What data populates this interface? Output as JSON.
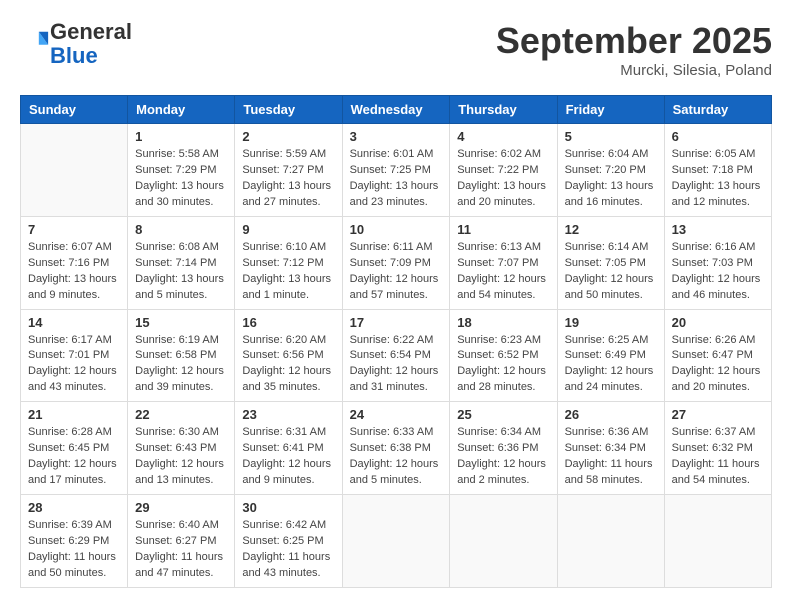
{
  "header": {
    "logo_general": "General",
    "logo_blue": "Blue",
    "month": "September 2025",
    "location": "Murcki, Silesia, Poland"
  },
  "days_of_week": [
    "Sunday",
    "Monday",
    "Tuesday",
    "Wednesday",
    "Thursday",
    "Friday",
    "Saturday"
  ],
  "weeks": [
    [
      {
        "day": null,
        "info": null
      },
      {
        "day": "1",
        "info": "Sunrise: 5:58 AM\nSunset: 7:29 PM\nDaylight: 13 hours\nand 30 minutes."
      },
      {
        "day": "2",
        "info": "Sunrise: 5:59 AM\nSunset: 7:27 PM\nDaylight: 13 hours\nand 27 minutes."
      },
      {
        "day": "3",
        "info": "Sunrise: 6:01 AM\nSunset: 7:25 PM\nDaylight: 13 hours\nand 23 minutes."
      },
      {
        "day": "4",
        "info": "Sunrise: 6:02 AM\nSunset: 7:22 PM\nDaylight: 13 hours\nand 20 minutes."
      },
      {
        "day": "5",
        "info": "Sunrise: 6:04 AM\nSunset: 7:20 PM\nDaylight: 13 hours\nand 16 minutes."
      },
      {
        "day": "6",
        "info": "Sunrise: 6:05 AM\nSunset: 7:18 PM\nDaylight: 13 hours\nand 12 minutes."
      }
    ],
    [
      {
        "day": "7",
        "info": "Sunrise: 6:07 AM\nSunset: 7:16 PM\nDaylight: 13 hours\nand 9 minutes."
      },
      {
        "day": "8",
        "info": "Sunrise: 6:08 AM\nSunset: 7:14 PM\nDaylight: 13 hours\nand 5 minutes."
      },
      {
        "day": "9",
        "info": "Sunrise: 6:10 AM\nSunset: 7:12 PM\nDaylight: 13 hours\nand 1 minute."
      },
      {
        "day": "10",
        "info": "Sunrise: 6:11 AM\nSunset: 7:09 PM\nDaylight: 12 hours\nand 57 minutes."
      },
      {
        "day": "11",
        "info": "Sunrise: 6:13 AM\nSunset: 7:07 PM\nDaylight: 12 hours\nand 54 minutes."
      },
      {
        "day": "12",
        "info": "Sunrise: 6:14 AM\nSunset: 7:05 PM\nDaylight: 12 hours\nand 50 minutes."
      },
      {
        "day": "13",
        "info": "Sunrise: 6:16 AM\nSunset: 7:03 PM\nDaylight: 12 hours\nand 46 minutes."
      }
    ],
    [
      {
        "day": "14",
        "info": "Sunrise: 6:17 AM\nSunset: 7:01 PM\nDaylight: 12 hours\nand 43 minutes."
      },
      {
        "day": "15",
        "info": "Sunrise: 6:19 AM\nSunset: 6:58 PM\nDaylight: 12 hours\nand 39 minutes."
      },
      {
        "day": "16",
        "info": "Sunrise: 6:20 AM\nSunset: 6:56 PM\nDaylight: 12 hours\nand 35 minutes."
      },
      {
        "day": "17",
        "info": "Sunrise: 6:22 AM\nSunset: 6:54 PM\nDaylight: 12 hours\nand 31 minutes."
      },
      {
        "day": "18",
        "info": "Sunrise: 6:23 AM\nSunset: 6:52 PM\nDaylight: 12 hours\nand 28 minutes."
      },
      {
        "day": "19",
        "info": "Sunrise: 6:25 AM\nSunset: 6:49 PM\nDaylight: 12 hours\nand 24 minutes."
      },
      {
        "day": "20",
        "info": "Sunrise: 6:26 AM\nSunset: 6:47 PM\nDaylight: 12 hours\nand 20 minutes."
      }
    ],
    [
      {
        "day": "21",
        "info": "Sunrise: 6:28 AM\nSunset: 6:45 PM\nDaylight: 12 hours\nand 17 minutes."
      },
      {
        "day": "22",
        "info": "Sunrise: 6:30 AM\nSunset: 6:43 PM\nDaylight: 12 hours\nand 13 minutes."
      },
      {
        "day": "23",
        "info": "Sunrise: 6:31 AM\nSunset: 6:41 PM\nDaylight: 12 hours\nand 9 minutes."
      },
      {
        "day": "24",
        "info": "Sunrise: 6:33 AM\nSunset: 6:38 PM\nDaylight: 12 hours\nand 5 minutes."
      },
      {
        "day": "25",
        "info": "Sunrise: 6:34 AM\nSunset: 6:36 PM\nDaylight: 12 hours\nand 2 minutes."
      },
      {
        "day": "26",
        "info": "Sunrise: 6:36 AM\nSunset: 6:34 PM\nDaylight: 11 hours\nand 58 minutes."
      },
      {
        "day": "27",
        "info": "Sunrise: 6:37 AM\nSunset: 6:32 PM\nDaylight: 11 hours\nand 54 minutes."
      }
    ],
    [
      {
        "day": "28",
        "info": "Sunrise: 6:39 AM\nSunset: 6:29 PM\nDaylight: 11 hours\nand 50 minutes."
      },
      {
        "day": "29",
        "info": "Sunrise: 6:40 AM\nSunset: 6:27 PM\nDaylight: 11 hours\nand 47 minutes."
      },
      {
        "day": "30",
        "info": "Sunrise: 6:42 AM\nSunset: 6:25 PM\nDaylight: 11 hours\nand 43 minutes."
      },
      {
        "day": null,
        "info": null
      },
      {
        "day": null,
        "info": null
      },
      {
        "day": null,
        "info": null
      },
      {
        "day": null,
        "info": null
      }
    ]
  ]
}
